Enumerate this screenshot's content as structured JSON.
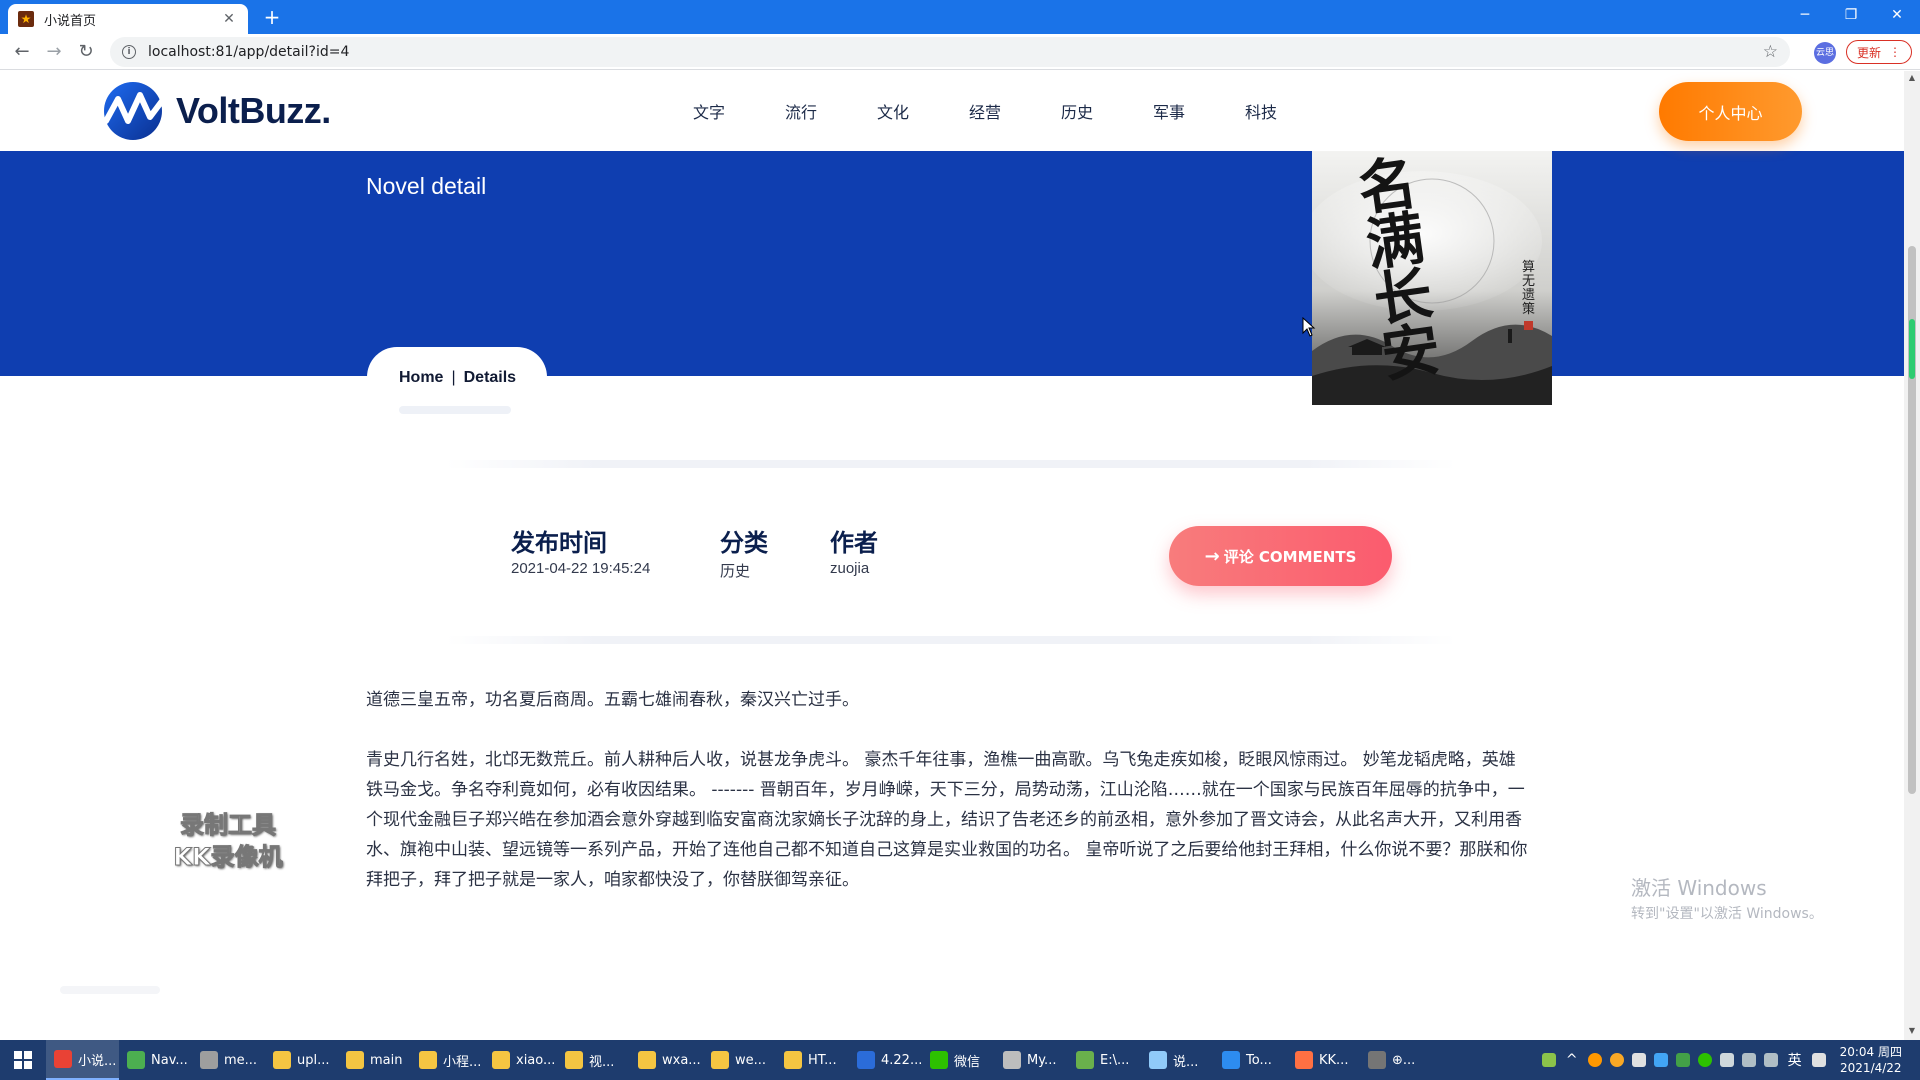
{
  "browser": {
    "tab_title": "小说首页",
    "tab_close": "✕",
    "new_tab": "+",
    "url": "localhost:81/app/detail?id=4",
    "profile_label": "云思",
    "update_label": "更新",
    "accent_color": "#1a73e8"
  },
  "header": {
    "brand": "VoltBuzz.",
    "nav": [
      "文字",
      "流行",
      "文化",
      "经营",
      "历史",
      "军事",
      "科技"
    ],
    "user_center": "个人中心"
  },
  "hero": {
    "title": "Novel detail",
    "background": "#0f3eb0"
  },
  "breadcrumb": {
    "home": "Home",
    "separator": "|",
    "current": "Details"
  },
  "cover": {
    "title_chars": "名满长安",
    "author_chars": "算无遗策"
  },
  "meta": {
    "publish_label": "发布时间",
    "publish_value": "2021-04-22 19:45:24",
    "category_label": "分类",
    "category_value": "历史",
    "author_label": "作者",
    "author_value": "zuojia"
  },
  "comments": {
    "arrow": "→",
    "label": "评论 COMMENTS"
  },
  "content": {
    "paragraph1": "道德三皇五帝，功名夏后商周。五霸七雄闹春秋，秦汉兴亡过手。",
    "paragraph2": "青史几行名姓，北邙无数荒丘。前人耕种后人收，说甚龙争虎斗。 豪杰千年往事，渔樵一曲高歌。乌飞兔走疾如梭，眨眼风惊雨过。 妙笔龙韬虎略，英雄铁马金戈。争名夺利竟如何，必有收因结果。 ------- 晋朝百年，岁月峥嵘，天下三分，局势动荡，江山沦陷……就在一个国家与民族百年屈辱的抗争中，一个现代金融巨子郑兴皓在参加酒会意外穿越到临安富商沈家嫡长子沈辞的身上，结识了告老还乡的前丞相，意外参加了晋文诗会，从此名声大开，又利用香水、旗袍中山装、望远镜等一系列产品，开始了连他自己都不知道自己这算是实业救国的功名。 皇帝听说了之后要给他封王拜相，什么你说不要？那朕和你拜把子，拜了把子就是一家人，咱家都快没了，你替朕御驾亲征。"
  },
  "overlays": {
    "recorder_line1": "录制工具",
    "recorder_line2": "KK录像机",
    "activate_line1": "激活 Windows",
    "activate_line2": "转到\"设置\"以激活 Windows。"
  },
  "taskbar": {
    "items": [
      {
        "label": "小说...",
        "color": "#e94235"
      },
      {
        "label": "Nav...",
        "color": "#4caf50"
      },
      {
        "label": "me...",
        "color": "#9e9e9e"
      },
      {
        "label": "upl...",
        "color": "#f4c542"
      },
      {
        "label": "main",
        "color": "#f4c542"
      },
      {
        "label": "小程...",
        "color": "#f4c542"
      },
      {
        "label": "xiao...",
        "color": "#f4c542"
      },
      {
        "label": "视...",
        "color": "#f4c542"
      },
      {
        "label": "wxa...",
        "color": "#f4c542"
      },
      {
        "label": "we...",
        "color": "#f4c542"
      },
      {
        "label": "HT...",
        "color": "#f4c542"
      },
      {
        "label": "4.22...",
        "color": "#2b6cd9"
      },
      {
        "label": "微信",
        "color": "#2dc100"
      },
      {
        "label": "My...",
        "color": "#bdbdbd"
      },
      {
        "label": "E:\\...",
        "color": "#6ab04c"
      },
      {
        "label": "说...",
        "color": "#90caf9"
      },
      {
        "label": "To...",
        "color": "#2d8cf0"
      },
      {
        "label": "KK...",
        "color": "#ff7043"
      },
      {
        "label": "⊕...",
        "color": "#757575"
      }
    ],
    "ime": "英",
    "time": "20:04 周四",
    "date": "2021/4/22"
  }
}
